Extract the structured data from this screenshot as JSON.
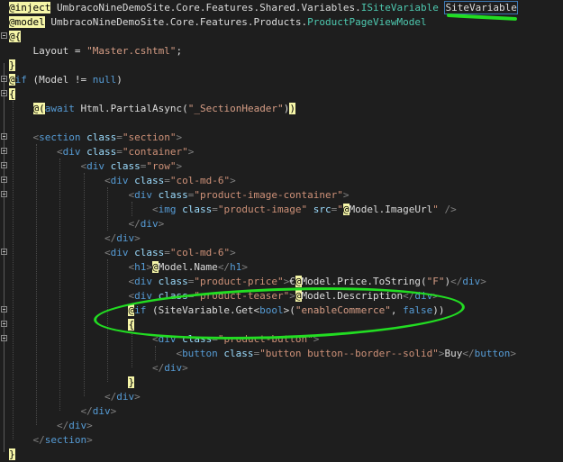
{
  "lines": [
    {
      "parts": [
        [
          "razor",
          "@inject"
        ],
        [
          "ns",
          " UmbracoNineDemoSite.Core.Features.Shared.Variables."
        ],
        [
          "ty",
          "ISiteVariable"
        ],
        [
          "ns",
          " "
        ],
        [
          "sel",
          "SiteVariable"
        ]
      ]
    },
    {
      "parts": [
        [
          "razor",
          "@model"
        ],
        [
          "ns",
          " UmbracoNineDemoSite.Core.Features.Products."
        ],
        [
          "ty",
          "ProductPageViewModel"
        ]
      ]
    },
    {
      "parts": [
        [
          "razor",
          "@{"
        ]
      ]
    },
    {
      "parts": [
        [
          "ns",
          "    Layout = "
        ],
        [
          "str",
          "\"Master.cshtml\""
        ],
        [
          "ns",
          ";"
        ]
      ]
    },
    {
      "parts": [
        [
          "razor",
          "}"
        ]
      ]
    },
    {
      "parts": [
        [
          "razor",
          "@"
        ],
        [
          "kw",
          "if"
        ],
        [
          "ns",
          " (Model != "
        ],
        [
          "kw",
          "null"
        ],
        [
          "ns",
          ")"
        ]
      ]
    },
    {
      "parts": [
        [
          "razor",
          "{"
        ]
      ]
    },
    {
      "parts": [
        [
          "ns",
          "    "
        ],
        [
          "razor",
          "@("
        ],
        [
          "kw",
          "await"
        ],
        [
          "ns",
          " Html.PartialAsync("
        ],
        [
          "str",
          "\"_SectionHeader\""
        ],
        [
          "ns",
          ")"
        ],
        [
          "razor",
          ")"
        ]
      ]
    },
    {
      "parts": []
    },
    {
      "parts": [
        [
          "ns",
          "    "
        ],
        [
          "tag",
          "<"
        ],
        [
          "tn",
          "section"
        ],
        [
          "an",
          " class"
        ],
        [
          "tag",
          "="
        ],
        [
          "av",
          "\"section\""
        ],
        [
          "tag",
          ">"
        ]
      ]
    },
    {
      "parts": [
        [
          "ns",
          "        "
        ],
        [
          "tag",
          "<"
        ],
        [
          "tn",
          "div"
        ],
        [
          "an",
          " class"
        ],
        [
          "tag",
          "="
        ],
        [
          "av",
          "\"container\""
        ],
        [
          "tag",
          ">"
        ]
      ]
    },
    {
      "parts": [
        [
          "ns",
          "            "
        ],
        [
          "tag",
          "<"
        ],
        [
          "tn",
          "div"
        ],
        [
          "an",
          " class"
        ],
        [
          "tag",
          "="
        ],
        [
          "av",
          "\"row\""
        ],
        [
          "tag",
          ">"
        ]
      ]
    },
    {
      "parts": [
        [
          "ns",
          "                "
        ],
        [
          "tag",
          "<"
        ],
        [
          "tn",
          "div"
        ],
        [
          "an",
          " class"
        ],
        [
          "tag",
          "="
        ],
        [
          "av",
          "\"col-md-6\""
        ],
        [
          "tag",
          ">"
        ]
      ]
    },
    {
      "parts": [
        [
          "ns",
          "                    "
        ],
        [
          "tag",
          "<"
        ],
        [
          "tn",
          "div"
        ],
        [
          "an",
          " class"
        ],
        [
          "tag",
          "="
        ],
        [
          "av",
          "\"product-image-container\""
        ],
        [
          "tag",
          ">"
        ]
      ]
    },
    {
      "parts": [
        [
          "ns",
          "                        "
        ],
        [
          "tag",
          "<"
        ],
        [
          "tn",
          "img"
        ],
        [
          "an",
          " class"
        ],
        [
          "tag",
          "="
        ],
        [
          "av",
          "\"product-image\""
        ],
        [
          "an",
          " src"
        ],
        [
          "tag",
          "="
        ],
        [
          "av",
          "\""
        ],
        [
          "razor",
          "@"
        ],
        [
          "ns",
          "Model.ImageUrl"
        ],
        [
          "av",
          "\""
        ],
        [
          "tag",
          " />"
        ]
      ]
    },
    {
      "parts": [
        [
          "ns",
          "                    "
        ],
        [
          "tag",
          "</"
        ],
        [
          "tn",
          "div"
        ],
        [
          "tag",
          ">"
        ]
      ]
    },
    {
      "parts": [
        [
          "ns",
          "                "
        ],
        [
          "tag",
          "</"
        ],
        [
          "tn",
          "div"
        ],
        [
          "tag",
          ">"
        ]
      ]
    },
    {
      "parts": [
        [
          "ns",
          "                "
        ],
        [
          "tag",
          "<"
        ],
        [
          "tn",
          "div"
        ],
        [
          "an",
          " class"
        ],
        [
          "tag",
          "="
        ],
        [
          "av",
          "\"col-md-6\""
        ],
        [
          "tag",
          ">"
        ]
      ]
    },
    {
      "parts": [
        [
          "ns",
          "                    "
        ],
        [
          "tag",
          "<"
        ],
        [
          "tn",
          "h1"
        ],
        [
          "tag",
          ">"
        ],
        [
          "razor",
          "@"
        ],
        [
          "ns",
          "Model.Name"
        ],
        [
          "tag",
          "</"
        ],
        [
          "tn",
          "h1"
        ],
        [
          "tag",
          ">"
        ]
      ]
    },
    {
      "parts": [
        [
          "ns",
          "                    "
        ],
        [
          "tag",
          "<"
        ],
        [
          "tn",
          "div"
        ],
        [
          "an",
          " class"
        ],
        [
          "tag",
          "="
        ],
        [
          "av",
          "\"product-price\""
        ],
        [
          "tag",
          ">"
        ],
        [
          "ns",
          "€"
        ],
        [
          "razor",
          "@"
        ],
        [
          "ns",
          "Model.Price.ToString("
        ],
        [
          "str",
          "\"F\""
        ],
        [
          "ns",
          ")"
        ],
        [
          "tag",
          "</"
        ],
        [
          "tn",
          "div"
        ],
        [
          "tag",
          ">"
        ]
      ]
    },
    {
      "parts": [
        [
          "ns",
          "                    "
        ],
        [
          "tag",
          "<"
        ],
        [
          "tn",
          "div"
        ],
        [
          "an",
          " class"
        ],
        [
          "tag",
          "="
        ],
        [
          "av",
          "\"product-teaser\""
        ],
        [
          "tag",
          ">"
        ],
        [
          "razor",
          "@"
        ],
        [
          "ns",
          "Model.Description"
        ],
        [
          "tag",
          "</"
        ],
        [
          "tn",
          "div"
        ],
        [
          "tag",
          ">"
        ]
      ]
    },
    {
      "parts": [
        [
          "ns",
          "                    "
        ],
        [
          "razor",
          "@"
        ],
        [
          "kw",
          "if"
        ],
        [
          "ns",
          " (SiteVariable.Get<"
        ],
        [
          "kw",
          "bool"
        ],
        [
          "ns",
          ">("
        ],
        [
          "str",
          "\"enableCommerce\""
        ],
        [
          "ns",
          ", "
        ],
        [
          "kw",
          "false"
        ],
        [
          "ns",
          "))"
        ]
      ]
    },
    {
      "parts": [
        [
          "ns",
          "                    "
        ],
        [
          "razor",
          "{"
        ]
      ]
    },
    {
      "parts": [
        [
          "ns",
          "                        "
        ],
        [
          "tag",
          "<"
        ],
        [
          "tn",
          "div"
        ],
        [
          "an",
          " class"
        ],
        [
          "tag",
          "="
        ],
        [
          "av",
          "\"product-button\""
        ],
        [
          "tag",
          ">"
        ]
      ]
    },
    {
      "parts": [
        [
          "ns",
          "                            "
        ],
        [
          "tag",
          "<"
        ],
        [
          "tn",
          "button"
        ],
        [
          "an",
          " class"
        ],
        [
          "tag",
          "="
        ],
        [
          "av",
          "\"button button--border--solid\""
        ],
        [
          "tag",
          ">"
        ],
        [
          "ns",
          "Buy"
        ],
        [
          "tag",
          "</"
        ],
        [
          "tn",
          "button"
        ],
        [
          "tag",
          ">"
        ]
      ]
    },
    {
      "parts": [
        [
          "ns",
          "                        "
        ],
        [
          "tag",
          "</"
        ],
        [
          "tn",
          "div"
        ],
        [
          "tag",
          ">"
        ]
      ]
    },
    {
      "parts": [
        [
          "ns",
          "                    "
        ],
        [
          "razor",
          "}"
        ]
      ]
    },
    {
      "parts": [
        [
          "ns",
          "                "
        ],
        [
          "tag",
          "</"
        ],
        [
          "tn",
          "div"
        ],
        [
          "tag",
          ">"
        ]
      ]
    },
    {
      "parts": [
        [
          "ns",
          "            "
        ],
        [
          "tag",
          "</"
        ],
        [
          "tn",
          "div"
        ],
        [
          "tag",
          ">"
        ]
      ]
    },
    {
      "parts": [
        [
          "ns",
          "        "
        ],
        [
          "tag",
          "</"
        ],
        [
          "tn",
          "div"
        ],
        [
          "tag",
          ">"
        ]
      ]
    },
    {
      "parts": [
        [
          "ns",
          "    "
        ],
        [
          "tag",
          "</"
        ],
        [
          "tn",
          "section"
        ],
        [
          "tag",
          ">"
        ]
      ]
    },
    {
      "parts": [
        [
          "razor",
          "}"
        ]
      ]
    }
  ],
  "colors": {
    "background": "#1e1e1e",
    "annotation": "#22dd22",
    "razor_highlight": "#f6f6a8"
  }
}
